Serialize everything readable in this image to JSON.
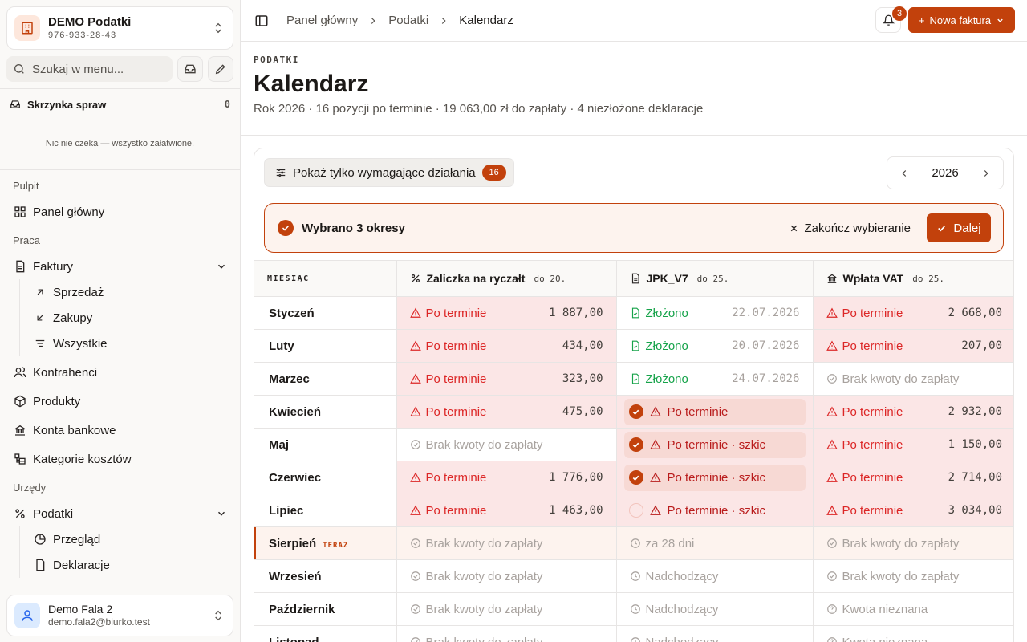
{
  "org": {
    "name": "DEMO Podatki",
    "nip": "976-933-28-43",
    "icon": "building-icon"
  },
  "search": {
    "placeholder": "Szukaj w menu..."
  },
  "inbox": {
    "label": "Skrzynka spraw",
    "count": "0",
    "empty": "Nic nie czeka — wszystko załatwione."
  },
  "nav": {
    "sections": [
      {
        "label": "Pulpit",
        "items": [
          {
            "label": "Panel główny",
            "icon": "grid-icon"
          }
        ]
      },
      {
        "label": "Praca",
        "items": [
          {
            "label": "Faktury",
            "icon": "document-icon",
            "expanded": true,
            "children": [
              {
                "label": "Sprzedaż",
                "icon": "arrow-up-right-icon"
              },
              {
                "label": "Zakupy",
                "icon": "arrow-down-left-icon"
              },
              {
                "label": "Wszystkie",
                "icon": "list-filter-icon"
              }
            ]
          },
          {
            "label": "Kontrahenci",
            "icon": "users-icon"
          },
          {
            "label": "Produkty",
            "icon": "package-icon"
          },
          {
            "label": "Konta bankowe",
            "icon": "bank-icon"
          },
          {
            "label": "Kategorie kosztów",
            "icon": "categories-icon"
          }
        ]
      },
      {
        "label": "Urzędy",
        "items": [
          {
            "label": "Podatki",
            "icon": "percent-icon",
            "expanded": true,
            "children": [
              {
                "label": "Przegląd",
                "icon": "pie-icon"
              },
              {
                "label": "Deklaracje",
                "icon": "file-icon"
              }
            ]
          }
        ]
      }
    ]
  },
  "user": {
    "name": "Demo Fala 2",
    "email": "demo.fala2@biurko.test"
  },
  "breadcrumb": [
    "Panel główny",
    "Podatki",
    "Kalendarz"
  ],
  "notifications": {
    "count": "3"
  },
  "new_invoice": {
    "label": "Nowa faktura"
  },
  "page": {
    "eyebrow": "PODATKI",
    "title": "Kalendarz",
    "subtitle": "Rok 2026 · 16 pozycji po terminie · 19 063,00 zł do zapłaty · 4 niezłożone deklaracje"
  },
  "filter": {
    "label": "Pokaż tylko wymagające działania",
    "count": "16"
  },
  "year": "2026",
  "selection": {
    "label": "Wybrano 3 okresy",
    "end_label": "Zakończ wybieranie",
    "next_label": "Dalej"
  },
  "colors": {
    "accent": "#c2410c",
    "overdue": "#dc2626",
    "filed": "#16a34a",
    "muted": "#a8a29e"
  },
  "table": {
    "headers": [
      {
        "label": "MIESIĄC"
      },
      {
        "label": "Zaliczka na ryczałt",
        "due": "do 20.",
        "icon": "percent-icon"
      },
      {
        "label": "JPK_V7",
        "due": "do 25.",
        "icon": "file-text-icon"
      },
      {
        "label": "Wpłata VAT",
        "due": "do 25.",
        "icon": "bank-icon"
      }
    ],
    "now_label": "TERAZ",
    "rows": [
      {
        "month": "Styczeń",
        "zal": {
          "s": "od",
          "t": "Po terminie",
          "v": "1 887,00"
        },
        "jpk": {
          "s": "ok",
          "t": "Złożono",
          "v": "22.07.2026"
        },
        "vat": {
          "s": "od",
          "t": "Po terminie",
          "v": "2 668,00"
        }
      },
      {
        "month": "Luty",
        "zal": {
          "s": "od",
          "t": "Po terminie",
          "v": "434,00"
        },
        "jpk": {
          "s": "ok",
          "t": "Złożono",
          "v": "20.07.2026"
        },
        "vat": {
          "s": "od",
          "t": "Po terminie",
          "v": "207,00"
        }
      },
      {
        "month": "Marzec",
        "zal": {
          "s": "od",
          "t": "Po terminie",
          "v": "323,00"
        },
        "jpk": {
          "s": "ok",
          "t": "Złożono",
          "v": "24.07.2026"
        },
        "vat": {
          "s": "na",
          "t": "Brak kwoty do zapłaty"
        }
      },
      {
        "month": "Kwiecień",
        "zal": {
          "s": "od",
          "t": "Po terminie",
          "v": "475,00"
        },
        "jpk": {
          "s": "sel",
          "t": "Po terminie",
          "checked": true
        },
        "vat": {
          "s": "od",
          "t": "Po terminie",
          "v": "2 932,00"
        }
      },
      {
        "month": "Maj",
        "zal": {
          "s": "na",
          "t": "Brak kwoty do zapłaty"
        },
        "jpk": {
          "s": "sel",
          "t": "Po terminie · szkic",
          "checked": true
        },
        "vat": {
          "s": "od",
          "t": "Po terminie",
          "v": "1 150,00"
        }
      },
      {
        "month": "Czerwiec",
        "zal": {
          "s": "od",
          "t": "Po terminie",
          "v": "1 776,00"
        },
        "jpk": {
          "s": "sel",
          "t": "Po terminie · szkic",
          "checked": true
        },
        "vat": {
          "s": "od",
          "t": "Po terminie",
          "v": "2 714,00"
        }
      },
      {
        "month": "Lipiec",
        "zal": {
          "s": "od",
          "t": "Po terminie",
          "v": "1 463,00"
        },
        "jpk": {
          "s": "sel",
          "t": "Po terminie · szkic",
          "checked": false
        },
        "vat": {
          "s": "od",
          "t": "Po terminie",
          "v": "3 034,00"
        }
      },
      {
        "month": "Sierpień",
        "current": true,
        "zal": {
          "s": "na",
          "t": "Brak kwoty do zapłaty"
        },
        "jpk": {
          "s": "up",
          "t": "za 28 dni"
        },
        "vat": {
          "s": "na",
          "t": "Brak kwoty do zapłaty"
        }
      },
      {
        "month": "Wrzesień",
        "zal": {
          "s": "na",
          "t": "Brak kwoty do zapłaty"
        },
        "jpk": {
          "s": "up",
          "t": "Nadchodzący"
        },
        "vat": {
          "s": "na",
          "t": "Brak kwoty do zapłaty"
        }
      },
      {
        "month": "Październik",
        "zal": {
          "s": "na",
          "t": "Brak kwoty do zapłaty"
        },
        "jpk": {
          "s": "up",
          "t": "Nadchodzący"
        },
        "vat": {
          "s": "un",
          "t": "Kwota nieznana"
        }
      },
      {
        "month": "Listopad",
        "zal": {
          "s": "na",
          "t": "Brak kwoty do zapłaty"
        },
        "jpk": {
          "s": "up",
          "t": "Nadchodzący"
        },
        "vat": {
          "s": "un",
          "t": "Kwota nieznana"
        }
      }
    ]
  }
}
